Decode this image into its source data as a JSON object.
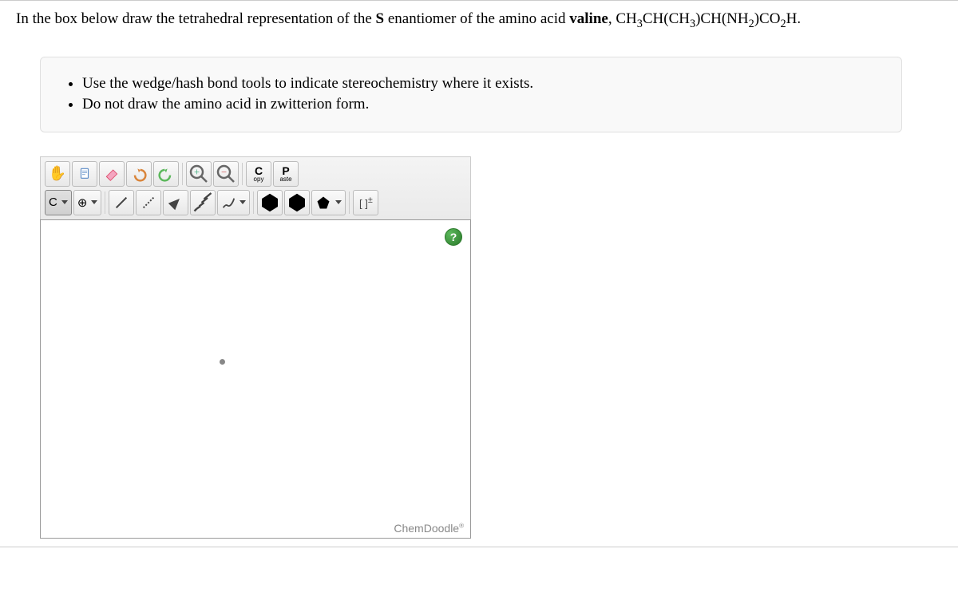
{
  "question": {
    "prefix": "In the box below draw the tetrahedral representation of the ",
    "bold1": "S",
    "mid": " enantiomer of the amino acid ",
    "bold2": "valine",
    "formula_prefix": ", CH",
    "f_sub1": "3",
    "f_mid1": "CH(CH",
    "f_sub2": "3",
    "f_mid2": ")CH(NH",
    "f_sub3": "2",
    "f_mid3": ")CO",
    "f_sub4": "2",
    "f_end": "H."
  },
  "instructions": [
    "Use the wedge/hash bond tools to indicate stereochemistry where it exists.",
    "Do not draw the amino acid in zwitterion form."
  ],
  "toolbar": {
    "copy_big": "C",
    "copy_small": "opy",
    "paste_big": "P",
    "paste_small": "aste",
    "element_label": "C",
    "charge_label": "[ ]",
    "charge_sup": "±"
  },
  "help": "?",
  "brand": "ChemDoodle",
  "brand_mark": "®"
}
